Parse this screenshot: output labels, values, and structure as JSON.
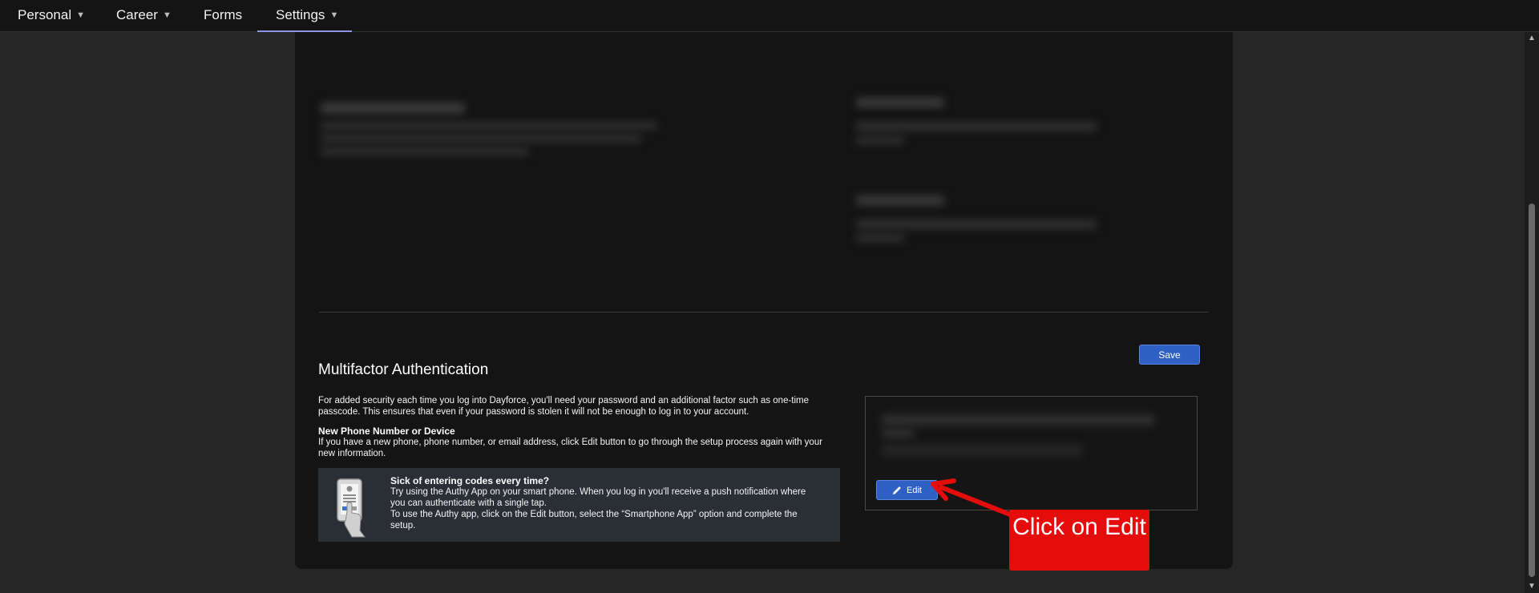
{
  "nav": {
    "items": [
      {
        "label": "Personal",
        "has_dropdown": true
      },
      {
        "label": "Career",
        "has_dropdown": true
      },
      {
        "label": "Forms",
        "has_dropdown": false
      },
      {
        "label": "Settings",
        "has_dropdown": true,
        "active": true
      }
    ],
    "caret_icon": "caret-down-icon"
  },
  "mfa": {
    "save_label": "Save",
    "title": "Multifactor Authentication",
    "intro": "For added security each time you log into Dayforce, you'll need your password and an additional factor such as one-time passcode. This ensures that even if your password is stolen it will not be enough to log in to your account.",
    "new_device_heading": "New Phone Number or Device",
    "new_device_text": "If you have a new phone, phone number, or email address, click Edit button to go through the setup process again with your new information.",
    "authy": {
      "icon": "smartphone-tap-icon",
      "title": "Sick of entering codes every time?",
      "line1": "Try using the Authy App on your smart phone. When you log in you'll receive a push notification where you can authenticate with a single tap.",
      "line2": "To use the Authy app, click on the Edit button, select the “Smartphone App” option and complete the setup."
    },
    "edit_label": "Edit",
    "edit_icon": "pencil-icon"
  },
  "annotation": {
    "text": "Click on Edit",
    "color": "#e50c0c"
  },
  "colors": {
    "accent_button": "#2f60c4",
    "nav_active_underline": "#8f94e0",
    "background": "#262626",
    "panel": "#141414"
  }
}
